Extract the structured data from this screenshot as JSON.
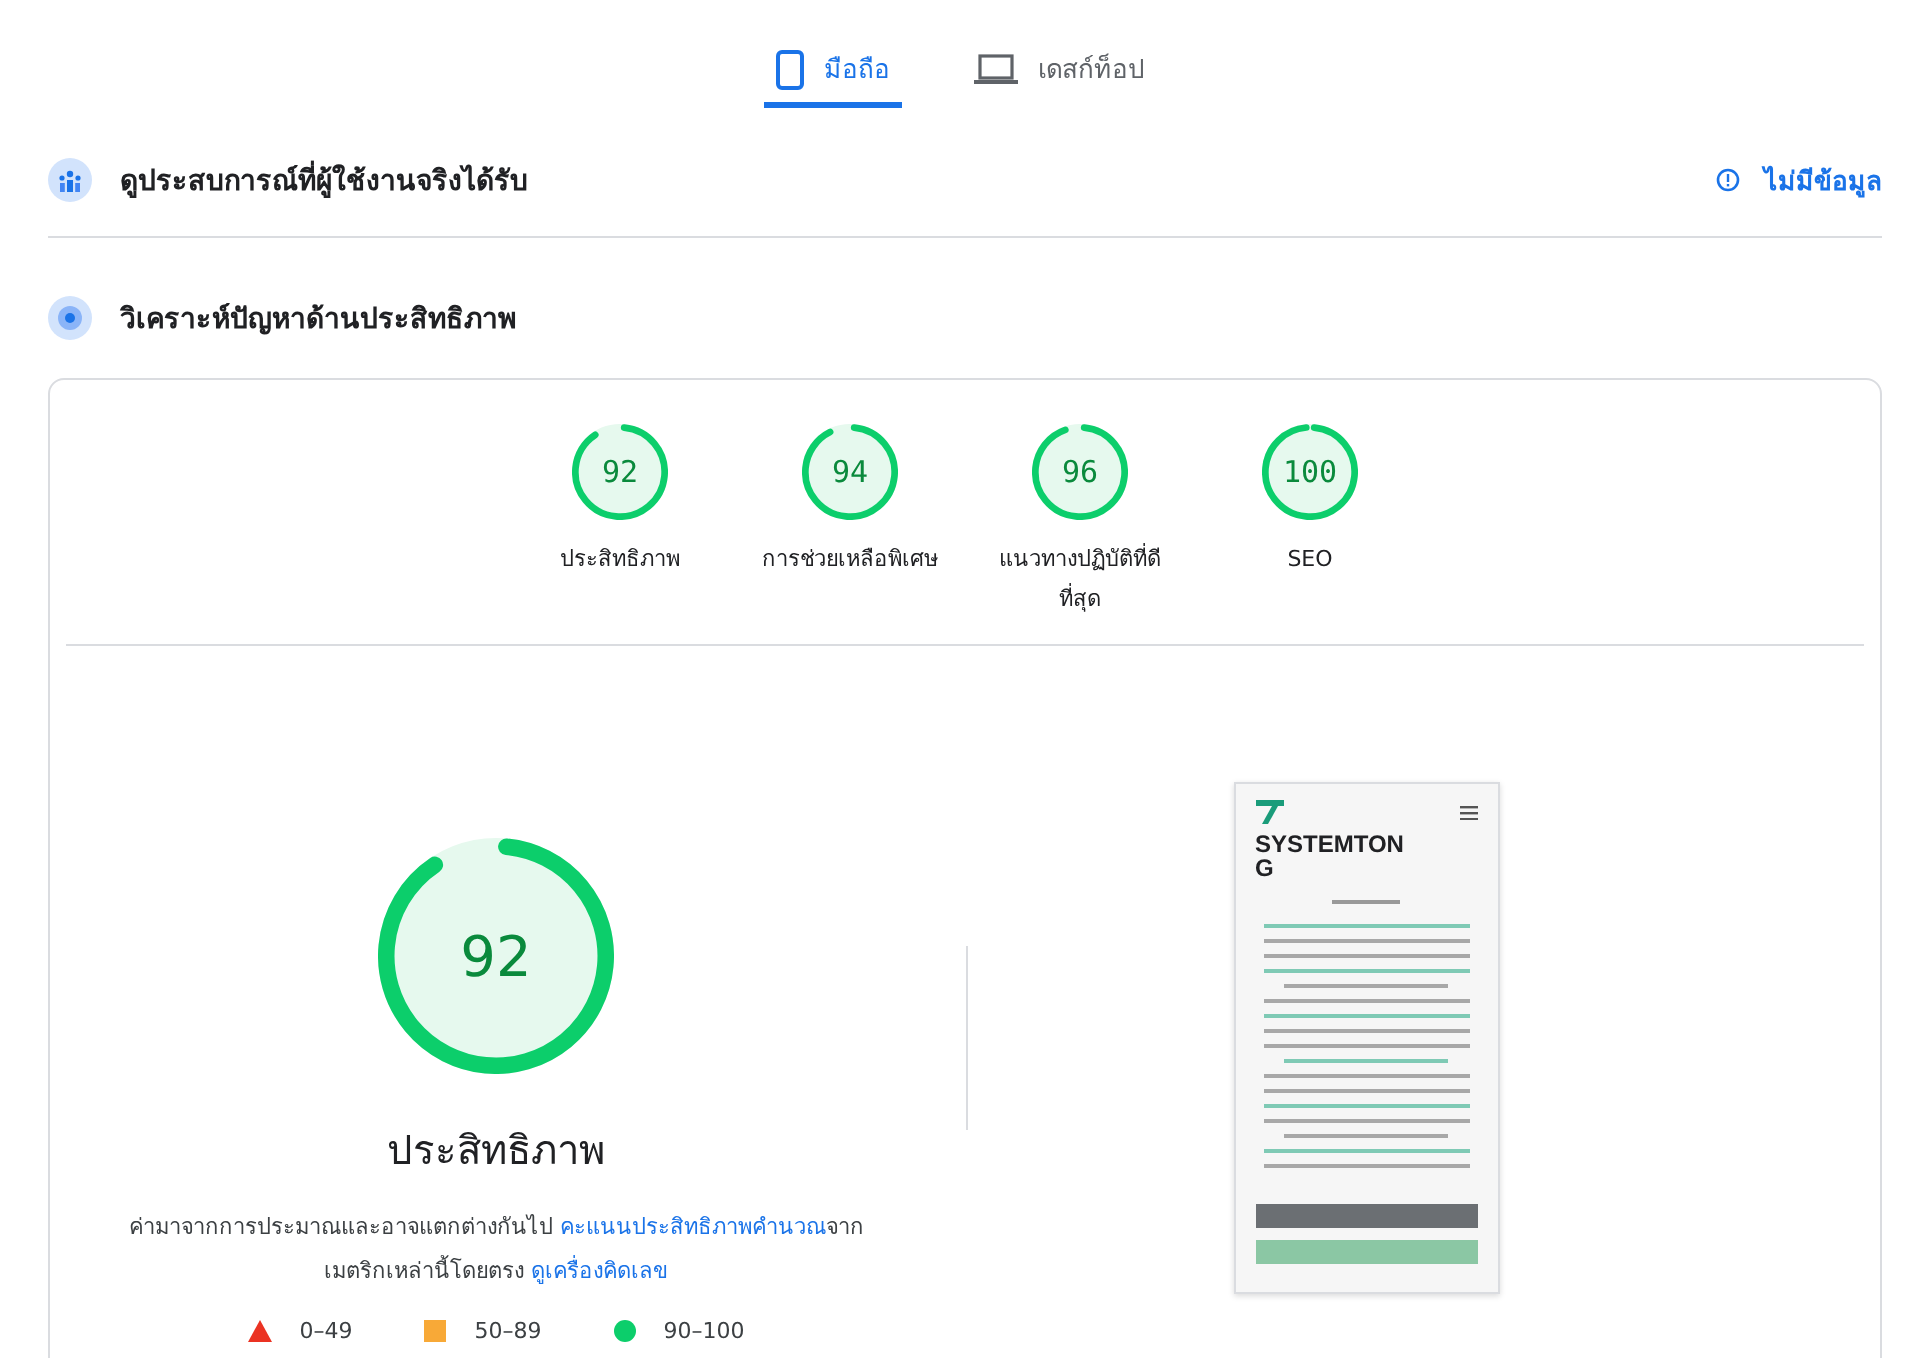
{
  "device_tabs": [
    {
      "label": "มือถือ",
      "kind": "phone",
      "selected": true
    },
    {
      "label": "เดสก์ท็อป",
      "kind": "laptop",
      "selected": false
    }
  ],
  "field_data": {
    "title": "ดูประสบการณ์ที่ผู้ใช้งานจริงได้รับ",
    "status": "ไม่มีข้อมูล"
  },
  "diagnose": {
    "title": "วิเคราะห์ปัญหาด้านประสิทธิภาพ"
  },
  "scores": [
    {
      "score": "92",
      "level": 0.92,
      "label": "ประสิทธิภาพ"
    },
    {
      "score": "94",
      "level": 0.94,
      "label": "การช่วยเหลือพิเศษ"
    },
    {
      "score": "96",
      "level": 0.96,
      "label": "แนวทางปฏิบัติที่ดีที่สุด"
    },
    {
      "score": "100",
      "level": 1,
      "label": "SEO"
    }
  ],
  "main_score": {
    "score": "92",
    "level": 0.92,
    "title": "ประสิทธิภาพ",
    "description": [
      {
        "kind": "text",
        "text": "ค่ามาจากการประมาณและอาจแตกต่างกันไป "
      },
      {
        "kind": "link",
        "text": "คะแนนประสิทธิภาพคำนวณ"
      },
      {
        "kind": "text",
        "text": "จากเมตริกเหล่านี้โดยตรง "
      },
      {
        "kind": "link",
        "text": "ดูเครื่องคิดเลข"
      }
    ],
    "legend": [
      {
        "kind": "triangle",
        "color": "#eb3323",
        "label": "0–49"
      },
      {
        "kind": "square",
        "color": "#f8a937",
        "label": "50–89"
      },
      {
        "kind": "circle",
        "color": "#0cce6b",
        "label": "90–100"
      }
    ]
  },
  "page_preview": {
    "brand": "SYSTEMTONG"
  }
}
